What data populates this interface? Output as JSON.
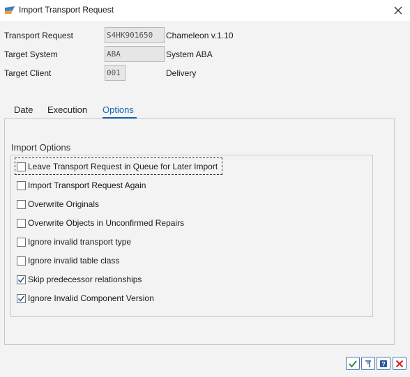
{
  "window": {
    "title": "Import Transport Request"
  },
  "fields": {
    "transport_request": {
      "label": "Transport Request",
      "value": "S4HK901650",
      "description": "Chameleon v.1.10"
    },
    "target_system": {
      "label": "Target System",
      "value": "ABA",
      "description": "System ABA"
    },
    "target_client": {
      "label": "Target Client",
      "value": "001",
      "description": "Delivery"
    }
  },
  "tabs": [
    {
      "label": "Date",
      "active": false
    },
    {
      "label": "Execution",
      "active": false
    },
    {
      "label": "Options",
      "active": true
    }
  ],
  "import_options": {
    "title": "Import Options",
    "items": [
      {
        "label": "Leave Transport Request in Queue for Later Import",
        "checked": false
      },
      {
        "label": "Import Transport Request Again",
        "checked": false
      },
      {
        "label": "Overwrite Originals",
        "checked": false
      },
      {
        "label": "Overwrite Objects in Unconfirmed Repairs",
        "checked": false
      },
      {
        "label": "Ignore invalid transport type",
        "checked": false
      },
      {
        "label": "Ignore invalid table class",
        "checked": false
      },
      {
        "label": "Skip predecessor relationships",
        "checked": true
      },
      {
        "label": "Ignore Invalid Component Version",
        "checked": true
      }
    ]
  },
  "footer_buttons": [
    {
      "icon": "checkmark-icon",
      "color": "#2e8b3a"
    },
    {
      "icon": "execute-icon",
      "color": "#2a5aa0"
    },
    {
      "icon": "help-icon",
      "color": "#2a5aa0"
    },
    {
      "icon": "cancel-icon",
      "color": "#d22"
    }
  ]
}
